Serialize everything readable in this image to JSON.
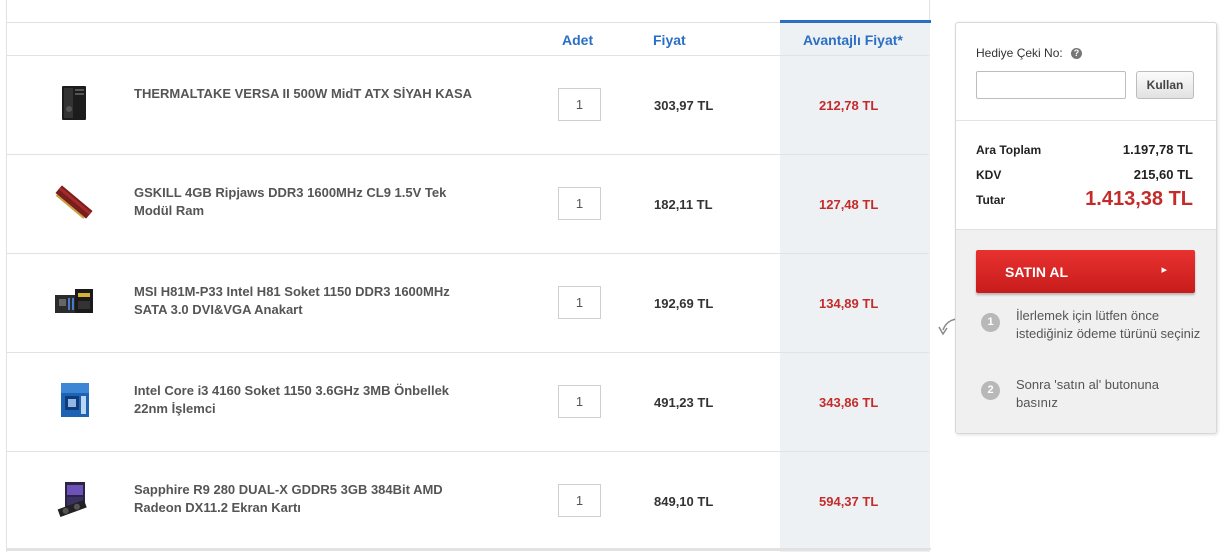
{
  "cart": {
    "headers": {
      "quantity": "Adet",
      "price": "Fiyat",
      "advantage_price": "Avantajlı Fiyat*"
    },
    "items": [
      {
        "name": "THERMALTAKE VERSA II 500W MidT ATX SİYAH KASA",
        "icon": "pc-case-icon",
        "quantity": "1",
        "price": "303,97 TL",
        "advantage_price": "212,78 TL"
      },
      {
        "name": "GSKILL 4GB Ripjaws DDR3 1600MHz CL9 1.5V Tek Modül Ram",
        "icon": "ram-icon",
        "quantity": "1",
        "price": "182,11 TL",
        "advantage_price": "127,48 TL"
      },
      {
        "name": "MSI H81M-P33 Intel H81 Soket 1150 DDR3 1600MHz SATA 3.0 DVI&VGA Anakart",
        "icon": "motherboard-icon",
        "quantity": "1",
        "price": "192,69 TL",
        "advantage_price": "134,89 TL"
      },
      {
        "name": "Intel Core i3 4160 Soket 1150 3.6GHz 3MB Önbellek 22nm İşlemci",
        "icon": "cpu-box-icon",
        "quantity": "1",
        "price": "491,23 TL",
        "advantage_price": "343,86 TL"
      },
      {
        "name": "Sapphire R9 280 DUAL-X GDDR5 3GB 384Bit AMD Radeon DX11.2 Ekran Kartı",
        "icon": "graphics-card-icon",
        "quantity": "1",
        "price": "849,10 TL",
        "advantage_price": "594,37 TL"
      }
    ]
  },
  "summary": {
    "gift_label": "Hediye Çeki No:",
    "help_icon": "question-icon",
    "gift_placeholder": "",
    "use_button": "Kullan",
    "subtotal_label": "Ara Toplam",
    "subtotal": "1.197,78 TL",
    "tax_label": "KDV",
    "tax": "215,60 TL",
    "total_label": "Tutar",
    "total": "1.413,38 TL",
    "buy_button": "SATIN AL",
    "buy_arrow": "▸",
    "steps": [
      {
        "num": "1",
        "text": "İlerlemek için lütfen önce istediğiniz ödeme türünü seçiniz"
      },
      {
        "num": "2",
        "text": "Sonra 'satın al' butonuna basınız"
      }
    ]
  },
  "colors": {
    "accent_blue": "#2a6fc5",
    "price_red": "#c42b2b",
    "buy_red": "#d42424"
  }
}
